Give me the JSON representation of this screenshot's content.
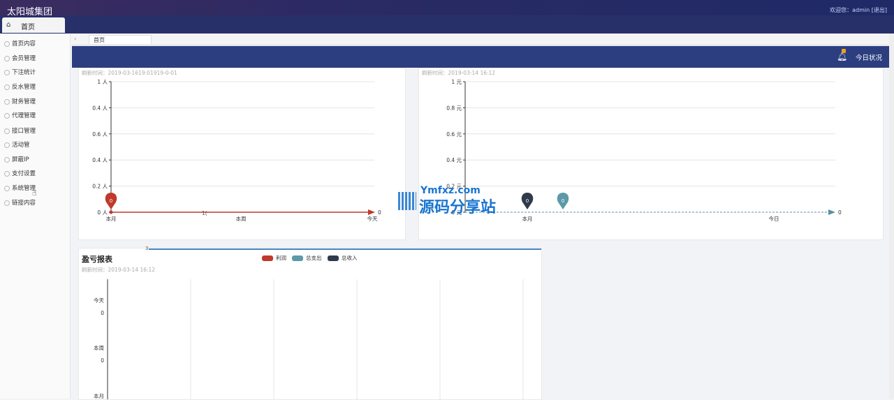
{
  "app": {
    "title": "太阳城集团",
    "welcome": "欢迎您：admin [退出]"
  },
  "home_tab": {
    "icon": "home-icon",
    "label": "首页"
  },
  "sidebar": {
    "items": [
      {
        "label": "首页内容"
      },
      {
        "label": "会员管理"
      },
      {
        "label": "下注统计"
      },
      {
        "label": "反水管理"
      },
      {
        "label": "财务管理"
      },
      {
        "label": "代理管理"
      },
      {
        "label": "接口管理"
      },
      {
        "label": "活动管"
      },
      {
        "label": "屏蔽IP"
      },
      {
        "label": "支付设置"
      },
      {
        "label": "系统管理"
      },
      {
        "label": "链接内容"
      }
    ]
  },
  "tabstrip": {
    "tab_label": "首页"
  },
  "banner": {
    "today_label": "今日状况",
    "bell_icon": "bell-icon",
    "badge_color": "#f0a020"
  },
  "card1": {
    "timestamp": "刷新时间：2019-03-1619:01919-0-01",
    "chart_data": {
      "type": "line",
      "categories": [
        "本月",
        "本周",
        "今天"
      ],
      "y_ticks": [
        "0 人",
        "0.2 人",
        "0.4 人",
        "0.6 人",
        "0.4 人",
        "1 人"
      ],
      "series": [
        {
          "values": [
            0,
            0,
            0
          ],
          "color": "#c0392b"
        }
      ],
      "marker_label": "0",
      "end_label": "0",
      "mid_label": "1("
    }
  },
  "card2": {
    "timestamp": "刷新时间：2019-03-14 16:12",
    "chart_data": {
      "type": "line",
      "categories": [
        "本月",
        "今日"
      ],
      "y_ticks": [
        "0 元",
        "0.2 元",
        "0.4 元",
        "0.6 元",
        "0.8 元",
        "1 元"
      ],
      "series": [
        {
          "values": [
            0,
            0
          ],
          "color": "#5b8fa0"
        }
      ],
      "marker_labels": [
        "0",
        "0"
      ],
      "end_label": "0"
    }
  },
  "card3": {
    "title": "盈亏报表",
    "timestamp": "刷新时间：2019-03-14 16:12",
    "left_marker": "3",
    "legend": [
      {
        "name": "利润",
        "color": "#c0392b"
      },
      {
        "name": "总支出",
        "color": "#5b9aa8"
      },
      {
        "name": "总收入",
        "color": "#2f3b4a"
      }
    ],
    "chart_data": {
      "type": "bar",
      "categories": [
        "今天",
        "本周",
        "本月"
      ],
      "value_labels": [
        "0",
        "0"
      ]
    }
  },
  "watermark": {
    "line1": "Ymfxz.com",
    "line2": "源码分享站"
  }
}
